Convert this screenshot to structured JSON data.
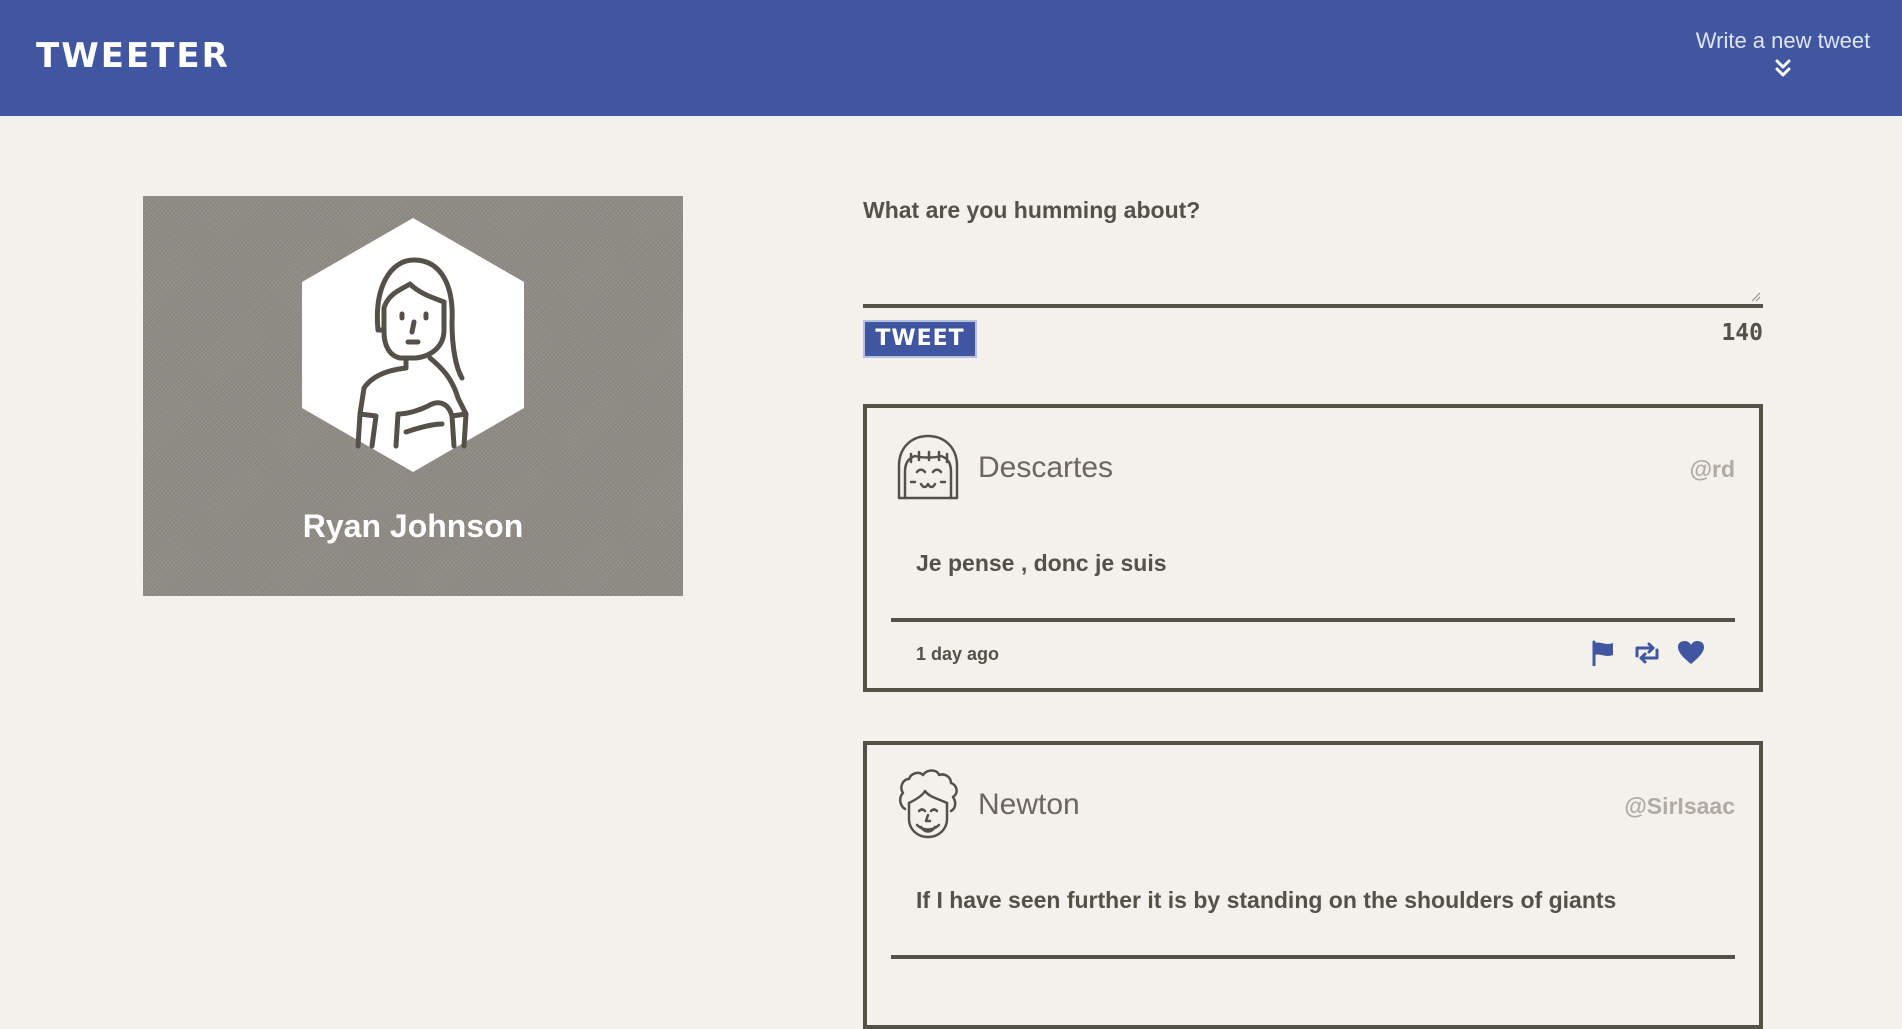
{
  "header": {
    "brand": "TWEETER",
    "compose_toggle_label": "Write a new tweet",
    "toggle_icon": "double-chevron-down-icon"
  },
  "profile": {
    "name": "Ryan Johnson",
    "avatar_icon": "woman-avatar-icon"
  },
  "compose": {
    "prompt": "What are you humming about?",
    "value": "",
    "button_label": "TWEET",
    "char_count": "140"
  },
  "tweets": [
    {
      "author": "Descartes",
      "handle": "@rd",
      "text": "Je pense , donc je suis",
      "time": "1 day ago",
      "avatar_icon": "girl-avatar-icon"
    },
    {
      "author": "Newton",
      "handle": "@SirIsaac",
      "text": "If I have seen further it is by standing on the shoulders of giants",
      "time": "",
      "avatar_icon": "curly-hair-avatar-icon"
    }
  ],
  "colors": {
    "accent": "#4056a1",
    "background": "#f4f1ec",
    "text": "#545149",
    "profile_bg": "#8f8b85",
    "handle": "#b0aca4"
  }
}
